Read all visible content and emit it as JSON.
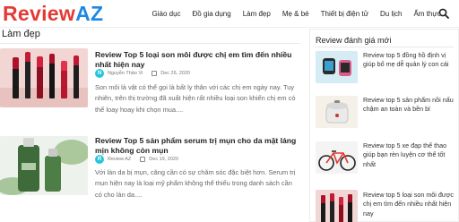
{
  "logo": {
    "part1": "Review",
    "part2": "AZ"
  },
  "nav": {
    "items": [
      "Giáo dục",
      "Đồ gia dụng",
      "Làm đẹp",
      "Mẹ & bé",
      "Thiết bị điện tử",
      "Du lịch",
      "Ẩm thực"
    ]
  },
  "section": {
    "title": "Làm đẹp"
  },
  "articles": [
    {
      "title": "Review Top 5 loại son môi được chị em tìm đến nhiều nhất hiện nay",
      "author": "Nguyễn Thảo Vi",
      "avatar_letter": "N",
      "date": "Dec 26, 2020",
      "excerpt": "Son môi là vật có thể gọi là bất ly thân với các chị em ngày nay. Tuy nhiên, trên thị trường đã xuất hiện rất nhiều loại son khiến chị em có thể loay hoay khi chọn mua...."
    },
    {
      "title": "Review Top 5 sản phẩm serum trị mụn cho da mặt láng mịn không còn mụn",
      "author": "Review AZ",
      "avatar_letter": "R",
      "date": "Dec 19, 2020",
      "excerpt": "Với làn da bị mụn, căng cần có sự chăm sóc đặc biệt hơn. Serum trị mụn hiện nay là loại mỹ phẩm không thể thiếu trong danh sách cần có cho làn da...."
    }
  ],
  "sidebar": {
    "title": "Review đánh giá mới",
    "items": [
      "Review top 5 đồng hồ định vị giúp bố mẹ dễ quản lý con cái",
      "Review top 5 sản phẩm nồi nấu chậm an toàn và bền bỉ",
      "Review top 5 xe đạp thể thao giúp bạn rèn luyện cơ thể tốt nhất",
      "Review top 5 loại son môi được chị em tìm đến nhiều nhất hiện nay"
    ]
  },
  "colors": {
    "logo_red": "#e53935",
    "logo_blue": "#1e88e5",
    "avatar": "#26c6da"
  }
}
